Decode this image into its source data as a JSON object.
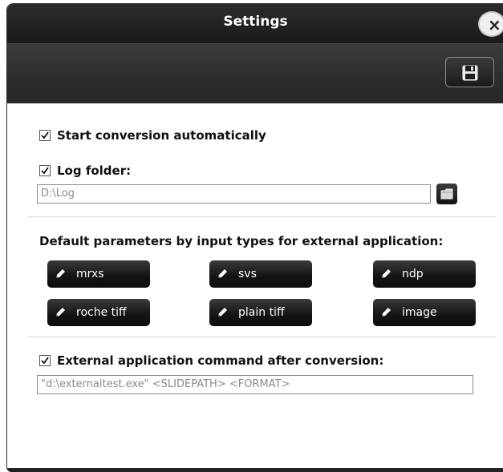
{
  "window": {
    "title": "Settings"
  },
  "toolbar": {
    "save_icon": "floppy-disk-icon",
    "close_icon": "close-icon",
    "close_glyph": "×"
  },
  "auto_convert": {
    "label": "Start conversion automatically",
    "checked": true
  },
  "log_folder": {
    "label": "Log folder:",
    "checked": true,
    "value": "D:\\Log",
    "browse_icon": "folder-icon"
  },
  "defaults_section": {
    "label": "Default parameters by input types for external application:",
    "buttons": [
      {
        "label": "mrxs",
        "icon": "pencil-icon"
      },
      {
        "label": "svs",
        "icon": "pencil-icon"
      },
      {
        "label": "ndp",
        "icon": "pencil-icon"
      },
      {
        "label": "roche tiff",
        "icon": "pencil-icon"
      },
      {
        "label": "plain tiff",
        "icon": "pencil-icon"
      },
      {
        "label": "image",
        "icon": "pencil-icon"
      }
    ]
  },
  "external_command": {
    "label": "External application command after conversion:",
    "checked": true,
    "value": "\"d:\\externaltest.exe\" <SLIDEPATH> <FORMAT>"
  },
  "colors": {
    "title_bar": "#1f1f1f",
    "toolbar": "#2f3130",
    "button": "#1a1a1a",
    "text": "#111111",
    "input_text": "#8a8a8a"
  }
}
